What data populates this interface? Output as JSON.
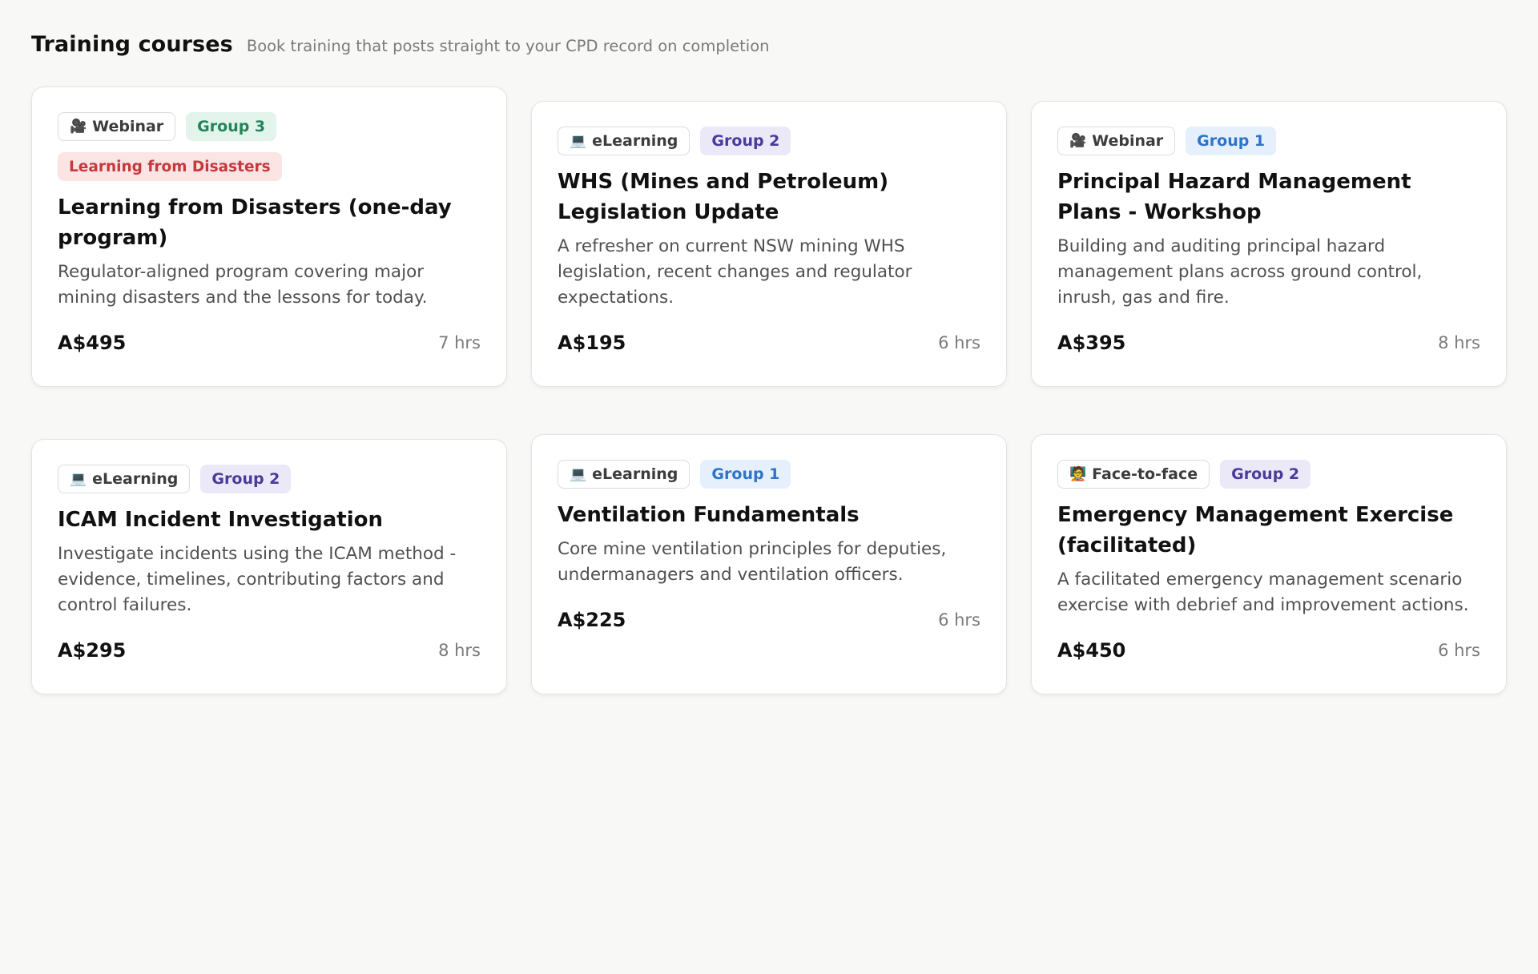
{
  "header": {
    "title": "Training courses",
    "subtitle": "Book training that posts straight to your CPD record on completion"
  },
  "courses": [
    {
      "format_icon": "video-camera-icon",
      "format_glyph": "🎥",
      "format": "Webinar",
      "group": "Group 3",
      "group_level": 3,
      "special_tag": "Learning from Disasters",
      "title": "Learning from Disasters (one-day program)",
      "description": "Regulator-aligned program covering major mining disasters and the lessons for today.",
      "price": "A$495",
      "duration": "7 hrs"
    },
    {
      "format_icon": "laptop-icon",
      "format_glyph": "💻",
      "format": "eLearning",
      "group": "Group 2",
      "group_level": 2,
      "title": "WHS (Mines and Petroleum) Legislation Update",
      "description": "A refresher on current NSW mining WHS legislation, recent changes and regulator expectations.",
      "price": "A$195",
      "duration": "6 hrs"
    },
    {
      "format_icon": "video-camera-icon",
      "format_glyph": "🎥",
      "format": "Webinar",
      "group": "Group 1",
      "group_level": 1,
      "title": "Principal Hazard Management Plans - Workshop",
      "description": "Building and auditing principal hazard management plans across ground control, inrush, gas and fire.",
      "price": "A$395",
      "duration": "8 hrs"
    },
    {
      "format_icon": "laptop-icon",
      "format_glyph": "💻",
      "format": "eLearning",
      "group": "Group 2",
      "group_level": 2,
      "title": "ICAM Incident Investigation",
      "description": "Investigate incidents using the ICAM method - evidence, timelines, contributing factors and control failures.",
      "price": "A$295",
      "duration": "8 hrs"
    },
    {
      "format_icon": "laptop-icon",
      "format_glyph": "💻",
      "format": "eLearning",
      "group": "Group 1",
      "group_level": 1,
      "title": "Ventilation Fundamentals",
      "description": "Core mine ventilation principles for deputies, undermanagers and ventilation officers.",
      "price": "A$225",
      "duration": "6 hrs"
    },
    {
      "format_icon": "teacher-icon",
      "format_glyph": "🧑‍🏫",
      "format": "Face-to-face",
      "group": "Group 2",
      "group_level": 2,
      "title": "Emergency Management Exercise (facilitated)",
      "description": "A facilitated emergency management scenario exercise with debrief and improvement actions.",
      "price": "A$450",
      "duration": "6 hrs"
    }
  ]
}
